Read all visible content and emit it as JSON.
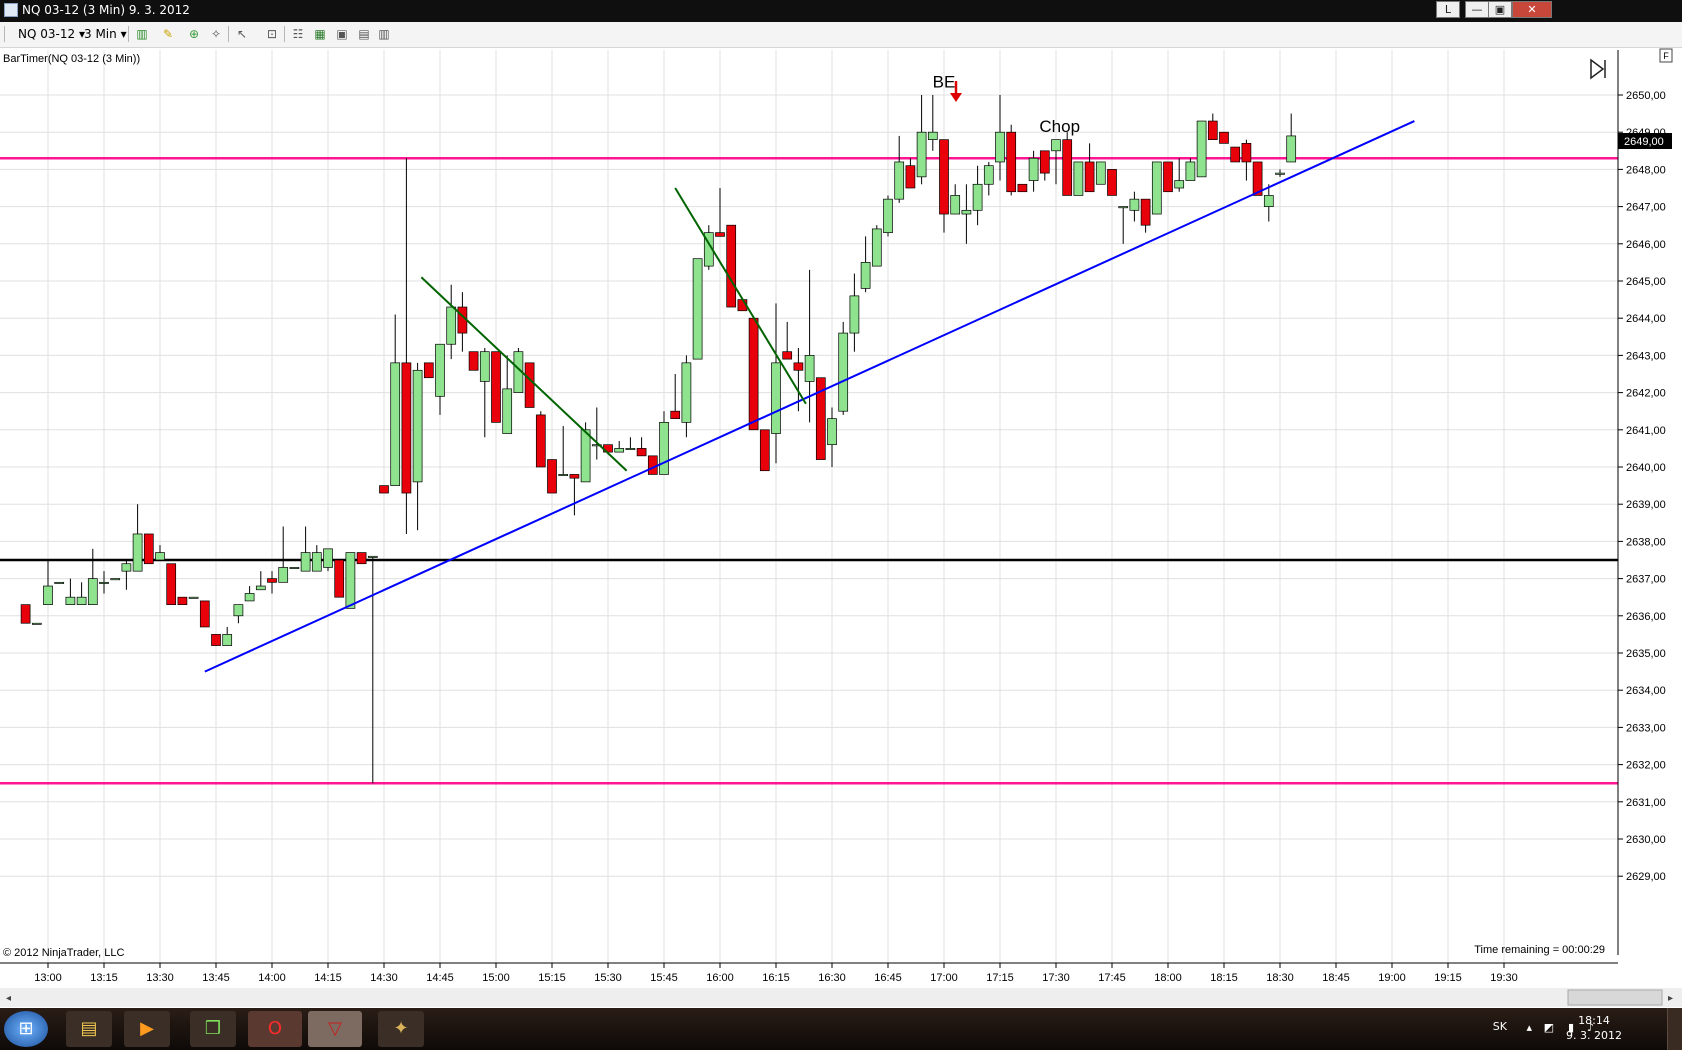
{
  "window": {
    "title": "NQ 03-12 (3 Min)  9. 3. 2012",
    "lock_label": "L",
    "minimize_label": "—",
    "restore_label": "▣",
    "close_label": "✕"
  },
  "toolbar": {
    "instrument": "NQ 03-12",
    "interval": "3 Min",
    "icons": [
      "bar-style-icon",
      "drawing-pencil-icon",
      "add-indicator-icon",
      "strategy-icon",
      "cursor-icon",
      "data-box-icon",
      "chart-properties-icon",
      "chart-trader-icon",
      "zoom-icon",
      "properties-icon"
    ]
  },
  "chart_data": {
    "type": "candlestick",
    "indicator_label": "BarTimer(NQ 03-12 (3 Min))",
    "copyright": "© 2012 NinjaTrader, LLC",
    "time_remaining": "Time remaining = 00:00:29",
    "panel_tag": "F",
    "last_price_label": "2649,00",
    "x_ticks": [
      "13:00",
      "13:15",
      "13:30",
      "13:45",
      "14:00",
      "14:15",
      "14:30",
      "14:45",
      "15:00",
      "15:15",
      "15:30",
      "15:45",
      "16:00",
      "16:15",
      "16:30",
      "16:45",
      "17:00",
      "17:15",
      "17:30",
      "17:45",
      "18:00",
      "18:15",
      "18:30",
      "18:45",
      "19:00",
      "19:15",
      "19:30"
    ],
    "y_ticks": [
      "2629,00",
      "2630,00",
      "2631,00",
      "2632,00",
      "2633,00",
      "2634,00",
      "2635,00",
      "2636,00",
      "2637,00",
      "2638,00",
      "2639,00",
      "2640,00",
      "2641,00",
      "2642,00",
      "2643,00",
      "2644,00",
      "2645,00",
      "2646,00",
      "2647,00",
      "2648,00",
      "2649,00",
      "2650,00"
    ],
    "ylim": [
      2628.6,
      2650.9
    ],
    "start_time": "12:54",
    "bar_minutes": 3,
    "candles": [
      [
        2636.3,
        2636.3,
        2635.8,
        2635.8
      ],
      [
        2635.8,
        2635.8,
        2635.8,
        2635.8
      ],
      [
        2636.3,
        2637.5,
        2636.3,
        2636.8
      ],
      [
        2636.9,
        2636.9,
        2636.9,
        2636.9
      ],
      [
        2636.3,
        2637.0,
        2636.3,
        2636.5
      ],
      [
        2636.3,
        2636.9,
        2636.3,
        2636.5
      ],
      [
        2636.3,
        2637.8,
        2636.3,
        2637.0
      ],
      [
        2636.9,
        2637.2,
        2636.6,
        2636.9
      ],
      [
        2637.0,
        2637.0,
        2637.0,
        2637.0
      ],
      [
        2637.2,
        2637.5,
        2636.7,
        2637.4
      ],
      [
        2637.2,
        2639.0,
        2637.2,
        2638.2
      ],
      [
        2638.2,
        2638.2,
        2637.4,
        2637.4
      ],
      [
        2637.5,
        2637.9,
        2637.5,
        2637.7
      ],
      [
        2637.4,
        2637.4,
        2636.3,
        2636.3
      ],
      [
        2636.5,
        2636.5,
        2636.3,
        2636.3
      ],
      [
        2636.5,
        2636.5,
        2636.5,
        2636.5
      ],
      [
        2636.4,
        2636.4,
        2635.7,
        2635.7
      ],
      [
        2635.5,
        2635.5,
        2635.2,
        2635.2
      ],
      [
        2635.2,
        2635.7,
        2635.2,
        2635.5
      ],
      [
        2636.0,
        2636.2,
        2635.8,
        2636.3
      ],
      [
        2636.4,
        2636.8,
        2636.4,
        2636.6
      ],
      [
        2636.7,
        2637.2,
        2636.7,
        2636.8
      ],
      [
        2637.0,
        2637.2,
        2636.6,
        2636.9
      ],
      [
        2636.9,
        2638.4,
        2636.9,
        2637.3
      ],
      [
        2637.3,
        2637.3,
        2637.3,
        2637.3
      ],
      [
        2637.2,
        2638.4,
        2637.2,
        2637.7
      ],
      [
        2637.2,
        2637.9,
        2637.2,
        2637.7
      ],
      [
        2637.3,
        2637.7,
        2637.2,
        2637.8
      ],
      [
        2637.5,
        2637.5,
        2636.5,
        2636.5
      ],
      [
        2636.2,
        2637.7,
        2636.2,
        2637.7
      ],
      [
        2637.7,
        2637.7,
        2637.4,
        2637.4
      ],
      [
        2637.6,
        2637.6,
        2631.5,
        2637.6
      ],
      [
        2639.5,
        2639.5,
        2639.3,
        2639.3
      ],
      [
        2639.5,
        2644.1,
        2639.5,
        2642.8
      ],
      [
        2642.8,
        2648.3,
        2638.2,
        2639.3
      ],
      [
        2639.6,
        2642.8,
        2638.3,
        2642.6
      ],
      [
        2642.8,
        2642.8,
        2642.4,
        2642.4
      ],
      [
        2641.9,
        2643.3,
        2641.4,
        2643.3
      ],
      [
        2643.3,
        2644.9,
        2642.9,
        2644.3
      ],
      [
        2644.3,
        2644.7,
        2643.1,
        2643.6
      ],
      [
        2643.1,
        2643.1,
        2642.6,
        2642.6
      ],
      [
        2642.3,
        2643.2,
        2640.8,
        2643.1
      ],
      [
        2643.1,
        2643.1,
        2641.2,
        2641.2
      ],
      [
        2640.9,
        2643.0,
        2640.9,
        2642.1
      ],
      [
        2642.0,
        2643.2,
        2642.0,
        2643.1
      ],
      [
        2642.8,
        2642.8,
        2641.6,
        2641.6
      ],
      [
        2641.4,
        2641.5,
        2640.0,
        2640.0
      ],
      [
        2640.2,
        2640.2,
        2639.3,
        2639.3
      ],
      [
        2639.8,
        2641.1,
        2639.8,
        2639.8
      ],
      [
        2639.8,
        2639.8,
        2638.7,
        2639.7
      ],
      [
        2639.6,
        2641.2,
        2639.6,
        2641.0
      ],
      [
        2640.6,
        2641.6,
        2640.2,
        2640.6
      ],
      [
        2640.6,
        2640.6,
        2640.4,
        2640.4
      ],
      [
        2640.4,
        2640.7,
        2640.4,
        2640.5
      ],
      [
        2640.5,
        2640.8,
        2640.5,
        2640.5
      ],
      [
        2640.5,
        2640.8,
        2640.3,
        2640.3
      ],
      [
        2640.3,
        2640.3,
        2639.8,
        2639.8
      ],
      [
        2639.8,
        2641.5,
        2639.8,
        2641.2
      ],
      [
        2641.5,
        2642.5,
        2641.3,
        2641.3
      ],
      [
        2641.2,
        2643.0,
        2640.8,
        2642.8
      ],
      [
        2642.9,
        2645.6,
        2642.9,
        2645.6
      ],
      [
        2645.4,
        2646.5,
        2645.3,
        2646.3
      ],
      [
        2646.3,
        2647.5,
        2646.2,
        2646.2
      ],
      [
        2646.5,
        2646.5,
        2644.3,
        2644.3
      ],
      [
        2644.5,
        2644.5,
        2644.2,
        2644.2
      ],
      [
        2644.0,
        2644.0,
        2641.0,
        2641.0
      ],
      [
        2641.0,
        2641.0,
        2639.9,
        2639.9
      ],
      [
        2640.9,
        2644.4,
        2640.1,
        2642.8
      ],
      [
        2643.1,
        2643.9,
        2643.1,
        2642.9
      ],
      [
        2642.8,
        2643.2,
        2641.5,
        2642.6
      ],
      [
        2642.3,
        2645.3,
        2641.2,
        2643.0
      ],
      [
        2642.4,
        2642.4,
        2640.2,
        2640.2
      ],
      [
        2640.6,
        2641.6,
        2640.0,
        2641.3
      ],
      [
        2641.5,
        2643.9,
        2641.4,
        2643.6
      ],
      [
        2643.6,
        2645.2,
        2643.1,
        2644.6
      ],
      [
        2644.8,
        2646.2,
        2644.7,
        2645.5
      ],
      [
        2645.4,
        2646.5,
        2645.4,
        2646.4
      ],
      [
        2646.3,
        2647.3,
        2646.2,
        2647.2
      ],
      [
        2647.2,
        2648.9,
        2647.1,
        2648.2
      ],
      [
        2648.1,
        2648.3,
        2647.5,
        2647.5
      ],
      [
        2647.8,
        2650.0,
        2647.6,
        2649.0
      ],
      [
        2648.8,
        2650.0,
        2648.5,
        2649.0
      ],
      [
        2648.8,
        2648.8,
        2646.3,
        2646.8
      ],
      [
        2646.8,
        2647.6,
        2646.8,
        2647.3
      ],
      [
        2646.8,
        2647.6,
        2646.0,
        2646.9
      ],
      [
        2646.9,
        2648.1,
        2646.5,
        2647.6
      ],
      [
        2647.6,
        2648.2,
        2647.3,
        2648.1
      ],
      [
        2648.2,
        2650.0,
        2647.7,
        2649.0
      ],
      [
        2649.0,
        2649.2,
        2647.3,
        2647.4
      ],
      [
        2647.6,
        2647.6,
        2647.4,
        2647.4
      ],
      [
        2647.7,
        2648.5,
        2647.4,
        2648.3
      ],
      [
        2648.5,
        2648.5,
        2647.7,
        2647.9
      ],
      [
        2648.5,
        2648.8,
        2647.6,
        2648.8
      ],
      [
        2648.8,
        2649.0,
        2647.3,
        2647.3
      ],
      [
        2647.3,
        2648.2,
        2647.3,
        2648.2
      ],
      [
        2648.2,
        2648.7,
        2647.4,
        2647.4
      ],
      [
        2647.6,
        2648.2,
        2647.6,
        2648.2
      ],
      [
        2648.0,
        2648.0,
        2647.3,
        2647.3
      ],
      [
        2647.0,
        2647.0,
        2646.0,
        2647.0
      ],
      [
        2646.9,
        2647.4,
        2646.6,
        2647.2
      ],
      [
        2647.2,
        2647.2,
        2646.3,
        2646.5
      ],
      [
        2646.8,
        2648.2,
        2646.8,
        2648.2
      ],
      [
        2648.2,
        2648.2,
        2647.4,
        2647.4
      ],
      [
        2647.5,
        2648.3,
        2647.4,
        2647.7
      ],
      [
        2647.7,
        2648.3,
        2647.7,
        2648.2
      ],
      [
        2647.8,
        2649.0,
        2647.8,
        2649.3
      ],
      [
        2649.3,
        2649.5,
        2648.8,
        2648.8
      ],
      [
        2649.0,
        2649.0,
        2648.7,
        2648.7
      ],
      [
        2648.6,
        2648.6,
        2648.2,
        2648.2
      ],
      [
        2648.7,
        2648.8,
        2647.7,
        2648.2
      ],
      [
        2648.2,
        2648.2,
        2647.3,
        2647.3
      ],
      [
        2647.0,
        2647.6,
        2646.6,
        2647.3
      ],
      [
        2647.9,
        2648.0,
        2647.8,
        2647.9
      ],
      [
        2648.2,
        2649.5,
        2648.2,
        2648.9
      ]
    ],
    "annotations": [
      {
        "text": "BE",
        "time": "17:00",
        "price": 2650.2
      },
      {
        "text": "Chop",
        "time": "17:31",
        "price": 2649.0
      }
    ],
    "horizontal_lines": [
      {
        "price": 2648.3,
        "color": "#ff1493"
      },
      {
        "price": 2637.5,
        "color": "#000000"
      },
      {
        "price": 2631.5,
        "color": "#ff1493"
      }
    ],
    "trend_lines": [
      {
        "from": [
          "13:42",
          2634.5
        ],
        "to": [
          "19:06",
          2649.3
        ],
        "color": "#0000ff"
      },
      {
        "from": [
          "14:40",
          2645.1
        ],
        "to": [
          "15:35",
          2639.9
        ],
        "color": "#006400"
      },
      {
        "from": [
          "15:48",
          2647.5
        ],
        "to": [
          "16:23",
          2641.7
        ],
        "color": "#006400"
      }
    ],
    "down_arrow": {
      "time": "17:00",
      "price": 2650.0,
      "color": "#dd0000"
    },
    "colors": {
      "up": "#8fe38f",
      "down": "#e8000b",
      "wick": "#000000",
      "grid": "#e0e0e0"
    }
  },
  "taskbar": {
    "apps": [
      "windows-start-icon",
      "file-explorer-icon",
      "media-player-icon",
      "book-app-icon",
      "opera-browser-icon",
      "ninjatrader-icon",
      "game-app-icon"
    ],
    "language": "SK",
    "time": "18:14",
    "date": "9. 3. 2012"
  }
}
